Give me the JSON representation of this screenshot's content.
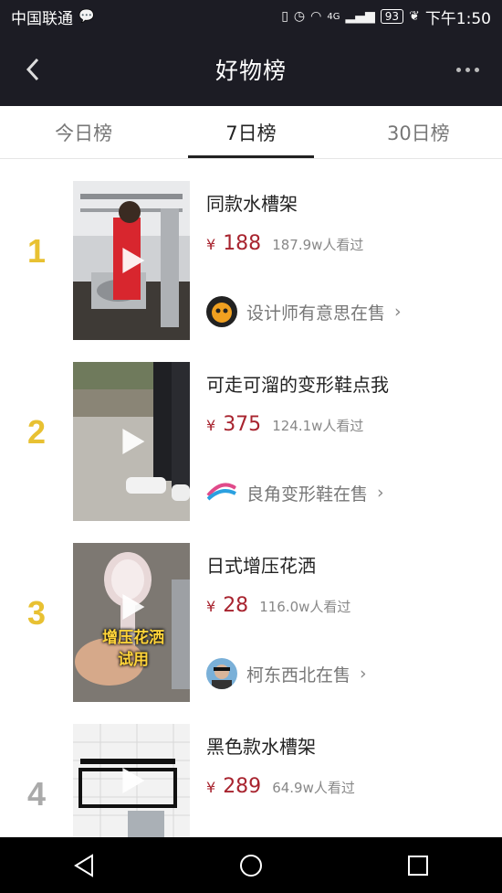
{
  "status": {
    "carrier": "中国联通",
    "signal": "4G",
    "battery": "93",
    "time": "下午1:50"
  },
  "header": {
    "title": "好物榜"
  },
  "tabs": [
    {
      "label": "今日榜",
      "active": false
    },
    {
      "label": "7日榜",
      "active": true
    },
    {
      "label": "30日榜",
      "active": false
    }
  ],
  "items": [
    {
      "rank": "1",
      "rank_color": "#e8c132",
      "title": "同款水槽架",
      "currency": "¥",
      "price": "188",
      "views": "187.9w人看过",
      "seller": "设计师有意思在售"
    },
    {
      "rank": "2",
      "rank_color": "#e8c132",
      "title": "可走可溜的变形鞋点我",
      "currency": "¥",
      "price": "375",
      "views": "124.1w人看过",
      "seller": "良角变形鞋在售"
    },
    {
      "rank": "3",
      "rank_color": "#e8c132",
      "title": "日式增压花洒",
      "currency": "¥",
      "price": "28",
      "views": "116.0w人看过",
      "seller": "柯东西北在售",
      "overlay_text": [
        "增压花洒",
        "试用"
      ]
    },
    {
      "rank": "4",
      "rank_color": "#aaaaaa",
      "title": "黑色款水槽架",
      "currency": "¥",
      "price": "289",
      "views": "64.9w人看过"
    }
  ],
  "colors": {
    "price": "#a8242f",
    "header_bg": "#1c1c24",
    "rank_top": "#e8c132",
    "rank_other": "#aaaaaa"
  }
}
